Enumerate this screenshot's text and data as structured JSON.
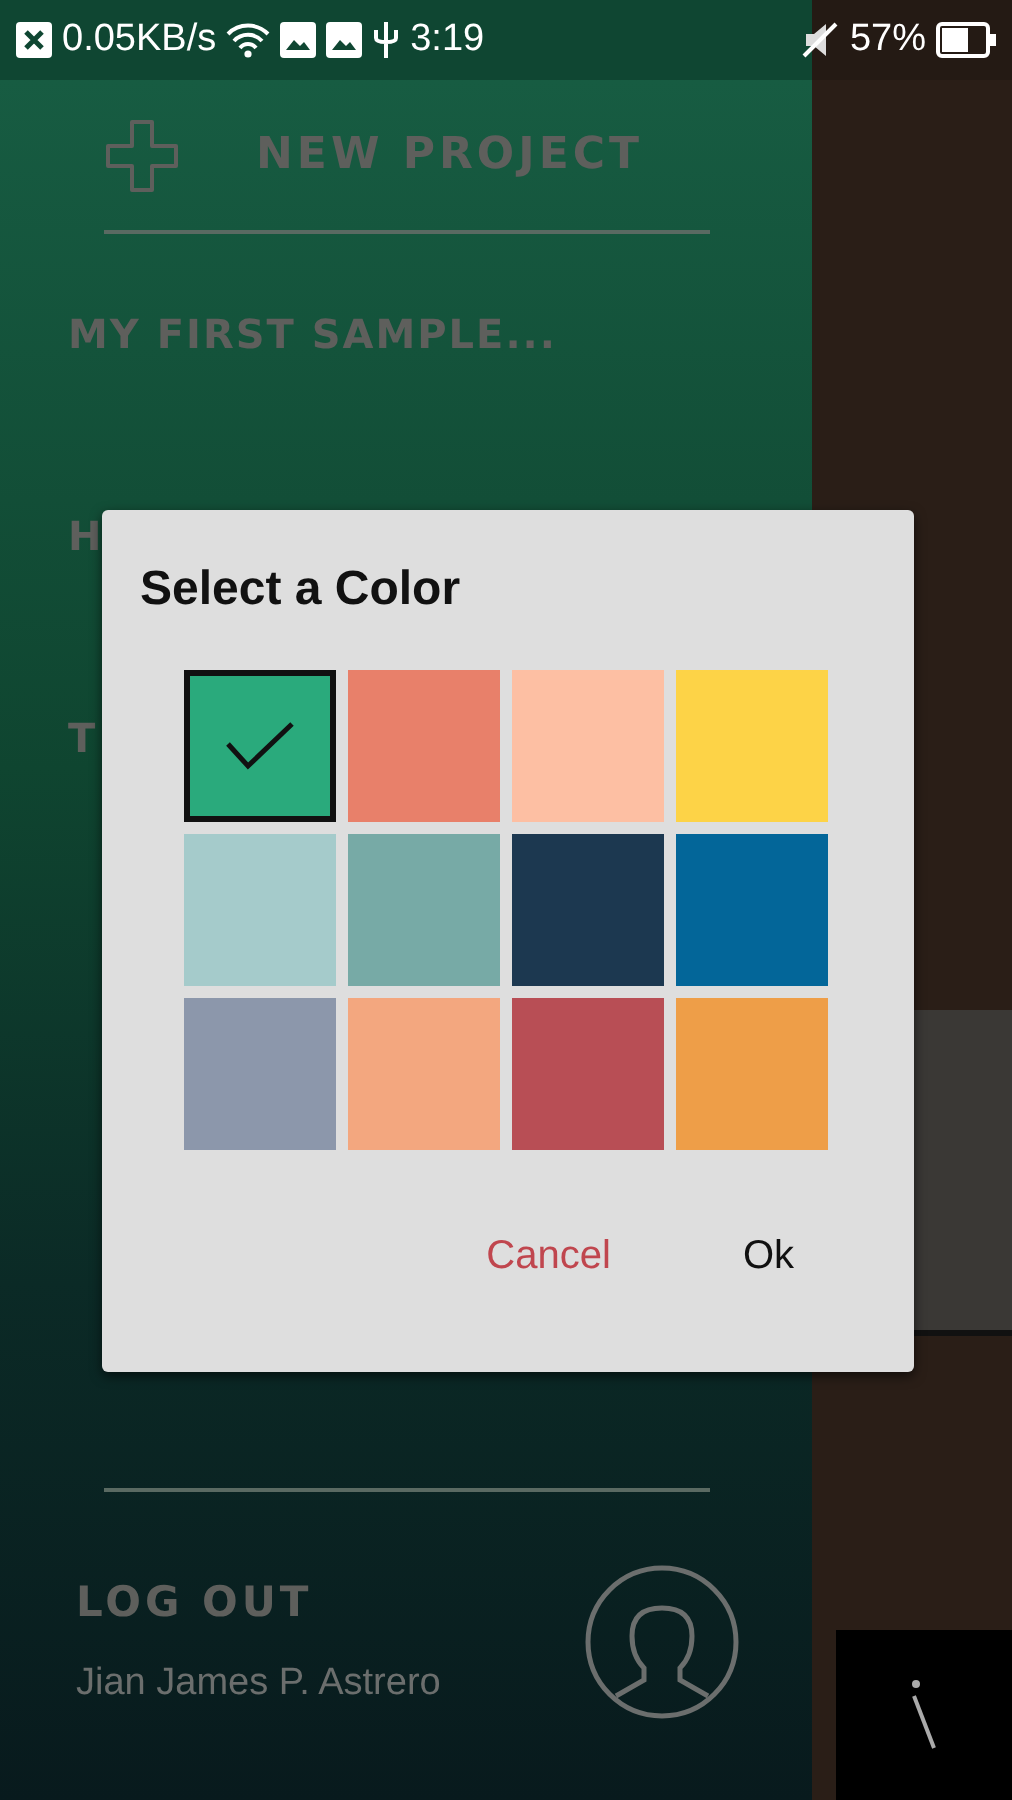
{
  "status_bar": {
    "speed": "0.05KB/s",
    "time": "3:19",
    "battery": "57%"
  },
  "drawer": {
    "new_project": "NEW PROJECT",
    "items": [
      "MY FIRST SAMPLE...",
      "H",
      "T"
    ],
    "logout": "LOG OUT",
    "user_name": "Jian James P. Astrero"
  },
  "dialog": {
    "title": "Select a Color",
    "swatches": [
      {
        "color": "#2aaa7c",
        "selected": true
      },
      {
        "color": "#e8806a",
        "selected": false
      },
      {
        "color": "#fdbfa3",
        "selected": false
      },
      {
        "color": "#fdd347",
        "selected": false
      },
      {
        "color": "#a5cbcb",
        "selected": false
      },
      {
        "color": "#77aaa6",
        "selected": false
      },
      {
        "color": "#1c3850",
        "selected": false
      },
      {
        "color": "#036699",
        "selected": false
      },
      {
        "color": "#8c97ab",
        "selected": false
      },
      {
        "color": "#f3a77f",
        "selected": false
      },
      {
        "color": "#b84e55",
        "selected": false
      },
      {
        "color": "#ee9e48",
        "selected": false
      }
    ],
    "buttons": [
      {
        "label": "Cancel",
        "kind": "cancel"
      },
      {
        "label": "Ok",
        "kind": "ok"
      }
    ]
  }
}
